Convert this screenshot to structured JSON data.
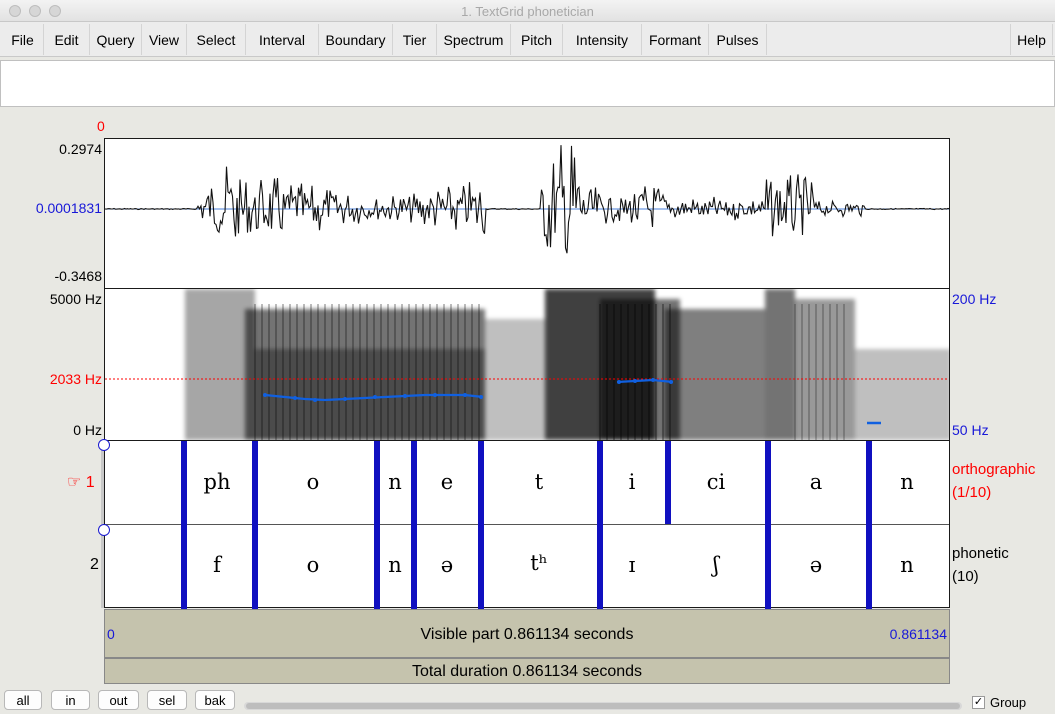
{
  "window": {
    "title": "1. TextGrid phonetician"
  },
  "menu": {
    "items": [
      "File",
      "Edit",
      "Query",
      "View",
      "Select",
      "Interval",
      "Boundary",
      "Tier",
      "Spectrum",
      "Pitch",
      "Intensity",
      "Formant",
      "Pulses"
    ],
    "help": "Help"
  },
  "waveform": {
    "cursor_time": "0",
    "max": "0.2974",
    "mid": "0.0001831",
    "min": "-0.3468"
  },
  "spectrogram": {
    "top": "5000 Hz",
    "cursor": "2033 Hz",
    "bottom": "0 Hz",
    "pitch_top": "200 Hz",
    "pitch_bottom": "50 Hz"
  },
  "tiers": [
    {
      "number": "1",
      "pointer_icon": "☞",
      "name": "orthographic",
      "count": "(1/10)",
      "segments": [
        "",
        "ph",
        "o",
        "n",
        "e",
        "t",
        "i",
        "ci",
        "a",
        "n"
      ]
    },
    {
      "number": "2",
      "name": "phonetic",
      "count": "(10)",
      "segments": [
        "",
        "f",
        "o",
        "n",
        "ə",
        "tʰ",
        "ɪ",
        "ʃ",
        "ə",
        "n"
      ]
    }
  ],
  "visible": {
    "start": "0",
    "label": "Visible part 0.861134 seconds",
    "end": "0.861134"
  },
  "total": {
    "label": "Total duration 0.861134 seconds"
  },
  "controls": {
    "all": "all",
    "in": "in",
    "out": "out",
    "sel": "sel",
    "bak": "bak",
    "group_label": "Group",
    "group_checked": true
  },
  "colors": {
    "boundary": "#1010c0",
    "selection": "#fafa50",
    "pitch": "#1060e0",
    "cursor": "#ff0000"
  }
}
